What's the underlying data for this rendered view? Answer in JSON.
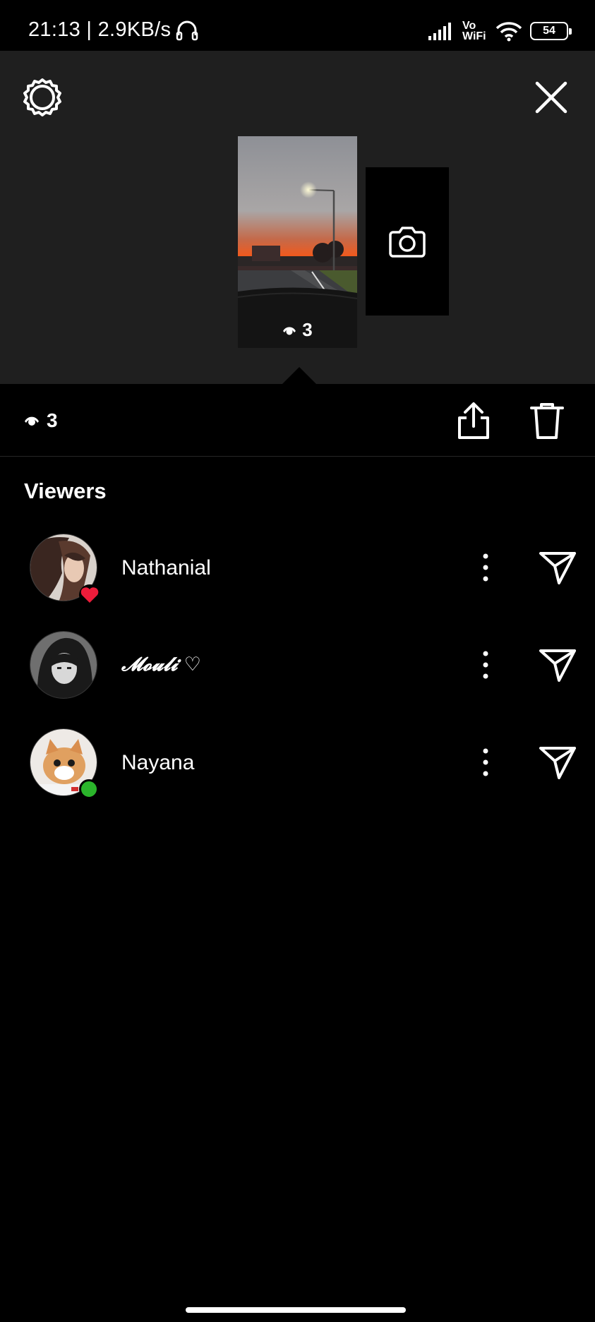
{
  "status_bar": {
    "time_speed": "21:13 | 2.9KB/s",
    "network": "Vo\nWiFi",
    "battery": "54"
  },
  "top": {
    "settings_icon": "gear-icon",
    "close_icon": "close-icon",
    "story_views": "3",
    "camera_icon": "camera-icon"
  },
  "actions": {
    "views_count": "3",
    "share_icon": "share-icon",
    "delete_icon": "trash-icon"
  },
  "viewers": {
    "title": "Viewers",
    "items": [
      {
        "name": "Nathanial",
        "badge": "heart"
      },
      {
        "name": "𝓜𝓸𝓾𝓵𝓲 ♡",
        "badge": "none"
      },
      {
        "name": "Nayana",
        "badge": "online"
      }
    ]
  },
  "colors": {
    "background": "#000000",
    "top_area": "#1f1f1f",
    "heart": "#ed1c3a",
    "online": "#2bb52b"
  }
}
